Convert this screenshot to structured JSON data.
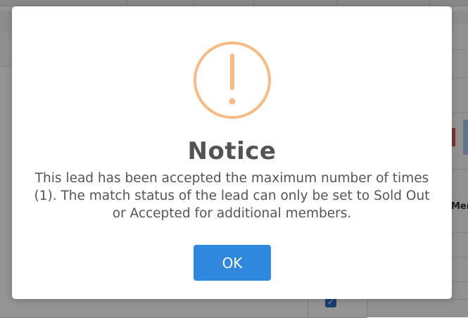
{
  "background": {
    "members_label": "Mem",
    "checkbox_glyph": "✓"
  },
  "dialog": {
    "icon": "warning-exclamation-icon",
    "icon_color": "#f8bb86",
    "title": "Notice",
    "message": "This lead has been accepted the maximum number of times (1). The match status of the lead can only be set to Sold Out or Accepted for additional members.",
    "ok_label": "OK",
    "ok_color": "#2f88de"
  }
}
